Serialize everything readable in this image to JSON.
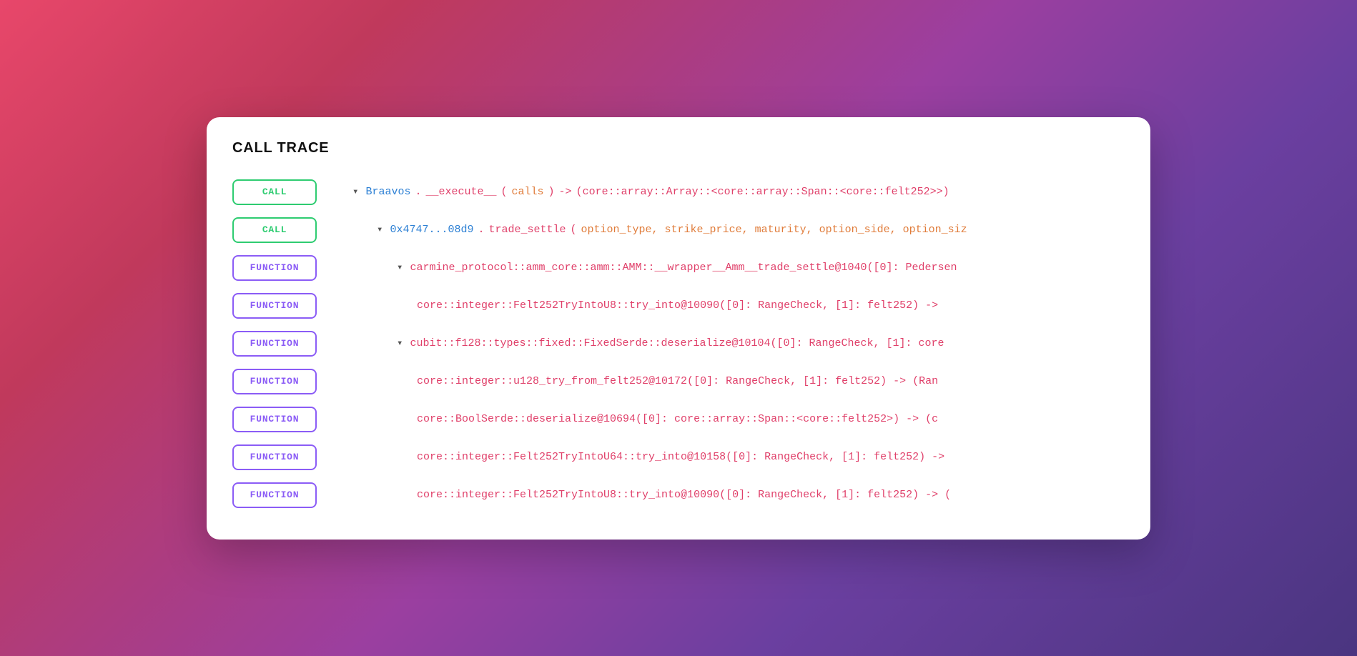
{
  "card": {
    "title": "CALL TRACE"
  },
  "rows": [
    {
      "id": "row-1",
      "badge": "CALL",
      "badge_type": "call",
      "indent": 1,
      "has_chevron": true,
      "content": [
        {
          "text": "Braavos",
          "color": "blue"
        },
        {
          "text": ".",
          "color": "pink"
        },
        {
          "text": "__execute__",
          "color": "pink"
        },
        {
          "text": "(",
          "color": "pink"
        },
        {
          "text": "calls",
          "color": "orange"
        },
        {
          "text": ")",
          "color": "pink"
        },
        {
          "text": "->",
          "color": "pink"
        },
        {
          "text": "(core::array::Array::<core::array::Span::<core::felt252>>)",
          "color": "pink"
        }
      ]
    },
    {
      "id": "row-2",
      "badge": "CALL",
      "badge_type": "call",
      "indent": 2,
      "has_chevron": true,
      "content": [
        {
          "text": "0x4747...08d9",
          "color": "blue"
        },
        {
          "text": ".",
          "color": "pink"
        },
        {
          "text": "trade_settle",
          "color": "pink"
        },
        {
          "text": "(",
          "color": "pink"
        },
        {
          "text": "option_type, strike_price, maturity, option_side, option_siz",
          "color": "orange"
        },
        {
          "text": "",
          "color": "pink"
        }
      ]
    },
    {
      "id": "row-3",
      "badge": "FUNCTION",
      "badge_type": "function",
      "indent": 3,
      "has_chevron": true,
      "content": [
        {
          "text": "carmine_protocol::amm_core::amm::AMM::__wrapper__Amm__trade_settle@1040([0]: Pedersen",
          "color": "pink"
        }
      ]
    },
    {
      "id": "row-4",
      "badge": "FUNCTION",
      "badge_type": "function",
      "indent": 4,
      "has_chevron": false,
      "content": [
        {
          "text": "core::integer::Felt252TryIntoU8::try_into@10090([0]: RangeCheck, [1]: felt252) ->",
          "color": "pink"
        }
      ]
    },
    {
      "id": "row-5",
      "badge": "FUNCTION",
      "badge_type": "function",
      "indent": 3,
      "has_chevron": true,
      "content": [
        {
          "text": "cubit::f128::types::fixed::FixedSerde::deserialize@10104([0]: RangeCheck, [1]: core",
          "color": "pink"
        }
      ]
    },
    {
      "id": "row-6",
      "badge": "FUNCTION",
      "badge_type": "function",
      "indent": 4,
      "has_chevron": false,
      "content": [
        {
          "text": "core::integer::u128_try_from_felt252@10172([0]: RangeCheck, [1]: felt252) -> (Ran",
          "color": "pink"
        }
      ]
    },
    {
      "id": "row-7",
      "badge": "FUNCTION",
      "badge_type": "function",
      "indent": 4,
      "has_chevron": false,
      "content": [
        {
          "text": "core::BoolSerde::deserialize@10694([0]: core::array::Span::<core::felt252>) -> (c",
          "color": "pink"
        }
      ]
    },
    {
      "id": "row-8",
      "badge": "FUNCTION",
      "badge_type": "function",
      "indent": 4,
      "has_chevron": false,
      "content": [
        {
          "text": "core::integer::Felt252TryIntoU64::try_into@10158([0]: RangeCheck, [1]: felt252) ->",
          "color": "pink"
        }
      ]
    },
    {
      "id": "row-9",
      "badge": "FUNCTION",
      "badge_type": "function",
      "indent": 4,
      "has_chevron": false,
      "content": [
        {
          "text": "core::integer::Felt252TryIntoU8::try_into@10090([0]: RangeCheck, [1]: felt252) -> (",
          "color": "pink"
        }
      ]
    }
  ]
}
